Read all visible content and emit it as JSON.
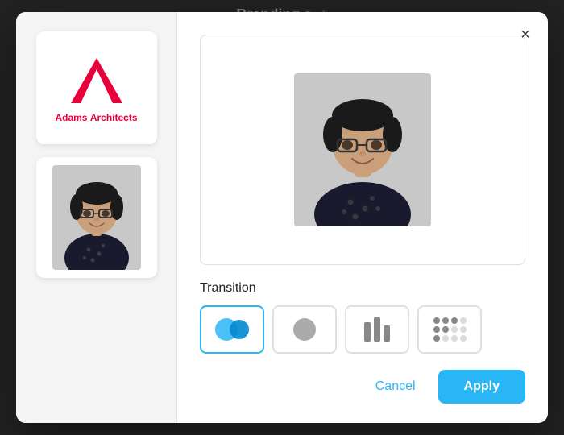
{
  "page": {
    "title": "Branding",
    "draft_badge": "Draft"
  },
  "modal": {
    "close_label": "×",
    "left_panel": {
      "logo": {
        "brand_name": "Adams",
        "brand_suffix": "Architects"
      },
      "photo_alt": "Person headshot"
    },
    "right_panel": {
      "preview_alt": "Person headshot preview",
      "transition_label": "Transition",
      "transition_options": [
        {
          "id": "dissolve",
          "label": "Dissolve",
          "active": true
        },
        {
          "id": "fade",
          "label": "Fade",
          "active": false
        },
        {
          "id": "slide",
          "label": "Slide",
          "active": false
        },
        {
          "id": "dots",
          "label": "Dots",
          "active": false
        }
      ],
      "cancel_label": "Cancel",
      "apply_label": "Apply"
    }
  }
}
